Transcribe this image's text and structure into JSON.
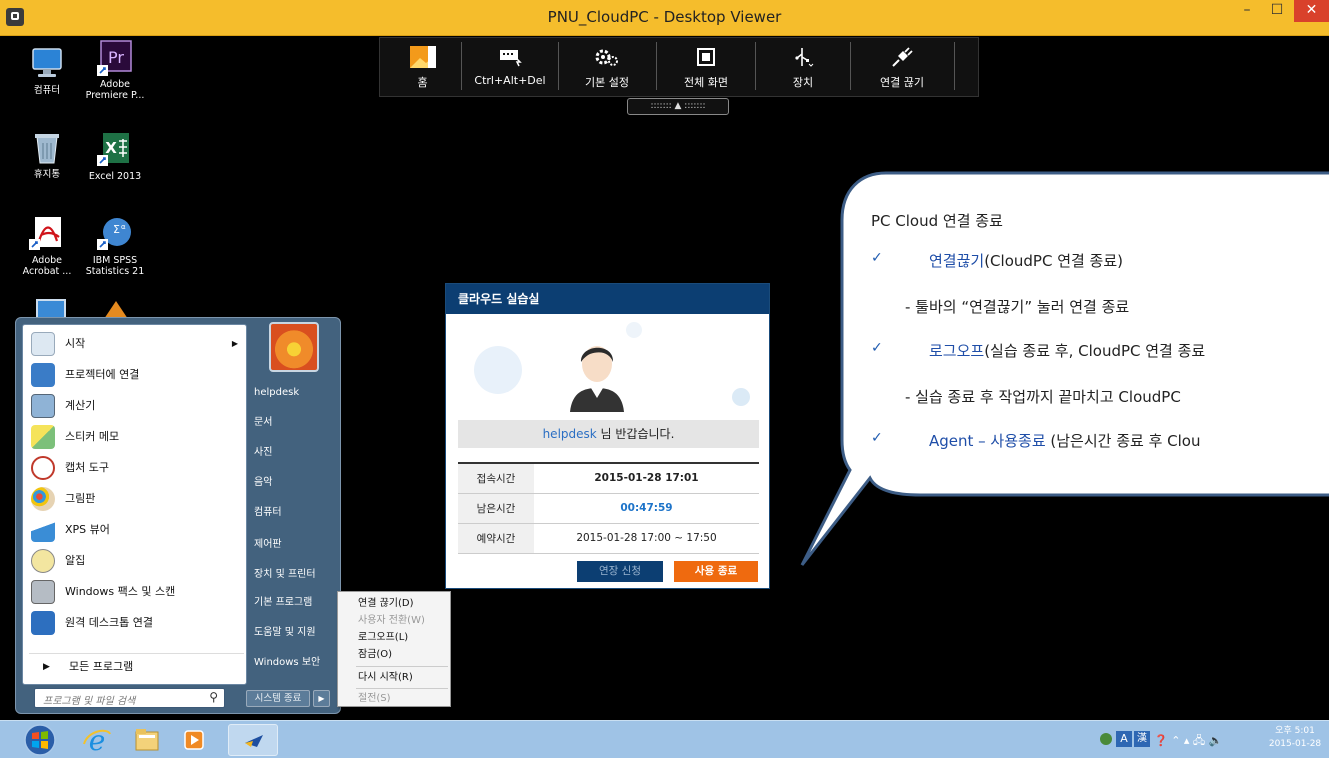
{
  "window": {
    "title": "PNU_CloudPC - Desktop Viewer",
    "minimize_glyph": "–",
    "maximize_glyph": "☐",
    "close_glyph": "✕"
  },
  "desktop_icons": [
    {
      "name": "computer",
      "label_1": "컴퓨터",
      "label_2": ""
    },
    {
      "name": "adobe-premiere",
      "label_1": "Adobe",
      "label_2": "Premiere P..."
    },
    {
      "name": "recycle-bin",
      "label_1": "휴지통",
      "label_2": ""
    },
    {
      "name": "excel-2013",
      "label_1": "Excel 2013",
      "label_2": ""
    },
    {
      "name": "adobe-acrobat",
      "label_1": "Adobe",
      "label_2": "Acrobat ..."
    },
    {
      "name": "ibm-spss",
      "label_1": "IBM SPSS",
      "label_2": "Statistics 21"
    }
  ],
  "viewer_toolbar": {
    "home": "홈",
    "ctrl_alt_del": "Ctrl+Alt+Del",
    "preferences": "기본 설정",
    "full_screen": "전체 화면",
    "devices": "장치",
    "disconnect": "연결 끊기",
    "handle": "::::::: ▲ :::::::"
  },
  "start_menu": {
    "left_items": [
      {
        "label": "시작",
        "icon": "getting-started-icon",
        "has_arrow": true
      },
      {
        "label": "프로젝터에 연결",
        "icon": "projector-icon"
      },
      {
        "label": "계산기",
        "icon": "calculator-icon"
      },
      {
        "label": "스티커 메모",
        "icon": "sticky-notes-icon"
      },
      {
        "label": "캡처 도구",
        "icon": "snipping-tool-icon"
      },
      {
        "label": "그림판",
        "icon": "paint-icon"
      },
      {
        "label": "XPS 뷰어",
        "icon": "xps-viewer-icon"
      },
      {
        "label": "알집",
        "icon": "alzip-icon"
      },
      {
        "label": "Windows 팩스 및 스캔",
        "icon": "fax-scan-icon"
      },
      {
        "label": "원격 데스크톱 연결",
        "icon": "remote-desktop-icon"
      }
    ],
    "all_programs": "모든 프로그램",
    "all_programs_arrow": "▶",
    "search_placeholder": "프로그램 및 파일 검색",
    "search_glyph": "⚲",
    "right_items": [
      "helpdesk",
      "문서",
      "사진",
      "음악",
      "컴퓨터",
      "제어판",
      "장치 및 프린터",
      "기본 프로그램",
      "도움말 및 지원",
      "Windows 보안"
    ],
    "shutdown_label": "시스템 종료",
    "shutdown_arrow": "▶"
  },
  "shutdown_menu": {
    "items": [
      {
        "label": "연결 끊기(D)",
        "disabled": false
      },
      {
        "label": "사용자 전환(W)",
        "disabled": true
      },
      {
        "label": "로그오프(L)",
        "disabled": false
      },
      {
        "label": "잠금(O)",
        "disabled": false
      },
      {
        "label": "다시 시작(R)",
        "disabled": false
      },
      {
        "label": "절전(S)",
        "disabled": true
      }
    ]
  },
  "cloud_dialog": {
    "header": "클라우드 실습실",
    "greeting_user": "helpdesk",
    "greeting_text": " 님 반갑습니다.",
    "rows": [
      {
        "key": "접속시간",
        "value": "2015-01-28 17:01"
      },
      {
        "key": "남은시간",
        "value": "00:47:59"
      },
      {
        "key": "예약시간",
        "value": "2015-01-28 17:00 ~ 17:50"
      }
    ],
    "extend_button": "연장 신청",
    "end_button": "사용 종료"
  },
  "callout": {
    "title": "PC Cloud 연결 종료",
    "check_glyph": "✓",
    "item1_link": "연결끊기",
    "item1_rest": "(CloudPC 연결 종료)",
    "item1_detail": "- 툴바의 “연결끊기” 눌러 연결 종료",
    "item2_link": "로그오프",
    "item2_rest": "(실습 종료 후, CloudPC 연결 종료",
    "item2_detail": "- 실습 종료 후 작업까지 끝마치고 CloudPC",
    "item3_link": "Agent – 사용종료",
    "item3_rest": " (남은시간 종료 후 Clou"
  },
  "taskbar": {
    "clock_time": "오후 5:01",
    "clock_date": "2015-01-28",
    "ime_a": "A",
    "ime_han": "漢",
    "tray_glyphs": "❓ ⌃ ▴ 🖧 🔈"
  },
  "colors": {
    "titlebar": "#f5bd2c",
    "dialog_header": "#0c3e72",
    "end_button": "#ef6a0f",
    "taskbar": "#9fc3e6",
    "link_blue": "#1f4ea8"
  }
}
